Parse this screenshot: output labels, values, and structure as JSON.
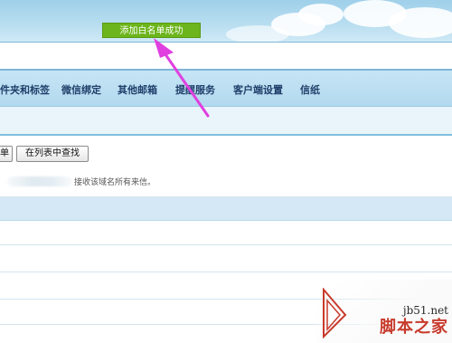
{
  "toast": {
    "text": "添加白名单成功"
  },
  "nav": {
    "items": [
      {
        "label": "件夹和标签"
      },
      {
        "label": "微信绑定"
      },
      {
        "label": "其他邮箱"
      },
      {
        "label": "提醒服务"
      },
      {
        "label": "客户端设置"
      },
      {
        "label": "信纸"
      }
    ]
  },
  "toolbar": {
    "partial_button_label": "单",
    "find_button_label": "在列表中查找",
    "info_text": "接收该域名所有来信。"
  },
  "watermark": {
    "url": "jb51.net",
    "name": "脚本之家"
  },
  "colors": {
    "toast": "#6cb51c",
    "arrow": "#e040e0",
    "nav_bg": "#b8dcf0"
  }
}
